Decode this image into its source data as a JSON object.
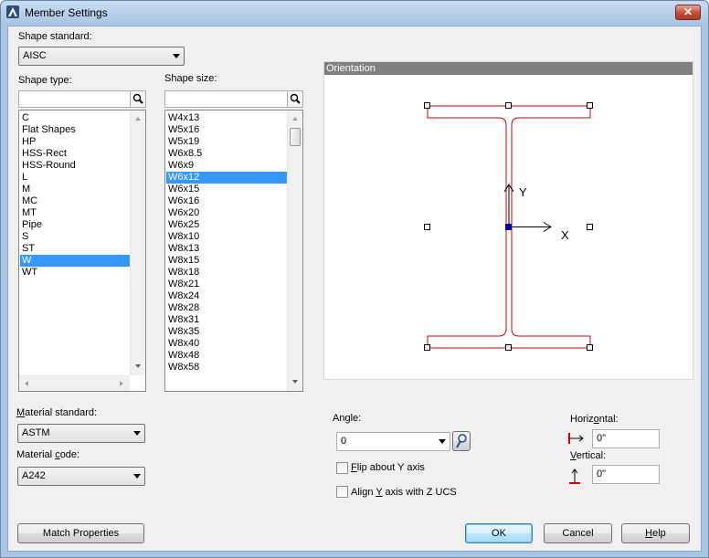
{
  "window": {
    "title": "Member Settings",
    "close_glyph": "✕"
  },
  "shape_standard": {
    "label": "Shape standard:",
    "value": "AISC"
  },
  "shape_type": {
    "label": "Shape type:",
    "search_value": "",
    "items": [
      "C",
      "Flat Shapes",
      "HP",
      "HSS-Rect",
      "HSS-Round",
      "L",
      "M",
      "MC",
      "MT",
      "Pipe",
      "S",
      "ST",
      "W",
      "WT"
    ],
    "selected": "W"
  },
  "shape_size": {
    "label": "Shape size:",
    "search_value": "",
    "items": [
      "W4x13",
      "W5x16",
      "W5x19",
      "W6x8.5",
      "W6x9",
      "W6x12",
      "W6x15",
      "W6x16",
      "W6x20",
      "W6x25",
      "W8x10",
      "W8x13",
      "W8x15",
      "W8x18",
      "W8x21",
      "W8x24",
      "W8x28",
      "W8x31",
      "W8x35",
      "W8x40",
      "W8x48",
      "W8x58"
    ],
    "selected": "W6x12"
  },
  "orientation": {
    "header": "Orientation",
    "y_axis": "Y",
    "x_axis": "X"
  },
  "material_standard": {
    "label": "Material standard:",
    "value": "ASTM"
  },
  "material_code": {
    "label": "Material code:",
    "value": "A242"
  },
  "angle": {
    "label": "Angle:",
    "value": "0"
  },
  "flip_y": {
    "label": "Flip about Y axis",
    "checked": false
  },
  "align_y": {
    "label": "Align Y axis with Z UCS",
    "checked": false
  },
  "horizontal": {
    "label": "Horizontal:",
    "value": "0\""
  },
  "vertical": {
    "label": "Vertical:",
    "value": "0\""
  },
  "buttons": {
    "match": "Match Properties",
    "ok": "OK",
    "cancel": "Cancel",
    "help": "Help"
  },
  "colors": {
    "selection": "#3399ff",
    "shape_outline": "#d00000",
    "orient_header": "#808080",
    "title_bar": "#a9c5e4"
  },
  "icons": {
    "app": "autocad-logo-icon",
    "search": "magnifier-icon",
    "pick": "pick-angle-icon",
    "horizontal": "horizontal-offset-icon",
    "vertical": "vertical-offset-icon"
  }
}
